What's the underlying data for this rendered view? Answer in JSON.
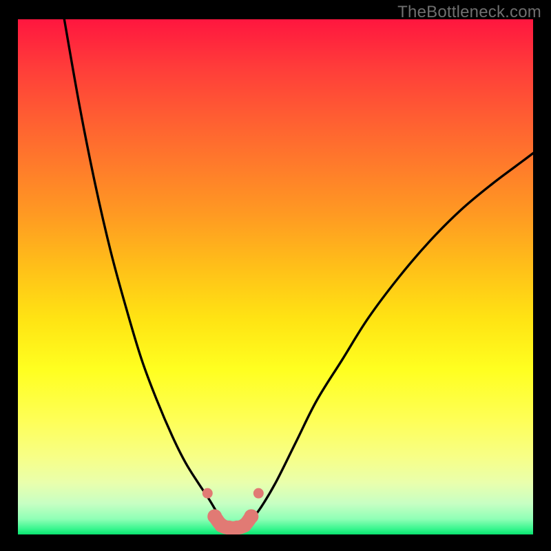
{
  "watermark": "TheBottleneck.com",
  "colors": {
    "background": "#000000",
    "curve": "#000000",
    "marker_fill": "#e17a74",
    "marker_stroke": "#d96a64",
    "watermark": "#6f6f6f"
  },
  "chart_data": {
    "type": "line",
    "title": "",
    "xlabel": "",
    "ylabel": "",
    "xlim": [
      0,
      100
    ],
    "ylim": [
      0,
      100
    ],
    "note": "Axes are unlabeled in the source image; x/y values are estimated from pixel positions on a 0–100 scale where (0,0) is bottom-left of the colored plot area.",
    "series": [
      {
        "name": "left-curve",
        "x": [
          9.0,
          12.0,
          15.0,
          18.0,
          21.0,
          24.0,
          27.0,
          30.0,
          32.5,
          35.0,
          37.0,
          38.5,
          39.5
        ],
        "y": [
          100.0,
          83.0,
          68.0,
          55.0,
          44.0,
          34.0,
          26.0,
          19.0,
          14.0,
          10.0,
          7.0,
          4.5,
          2.8
        ]
      },
      {
        "name": "right-curve",
        "x": [
          45.0,
          47.0,
          50.0,
          54.0,
          58.0,
          63.0,
          68.0,
          74.0,
          80.0,
          86.0,
          92.0,
          98.0,
          100.0
        ],
        "y": [
          2.5,
          5.0,
          10.0,
          18.0,
          26.0,
          34.0,
          42.0,
          50.0,
          57.0,
          63.0,
          68.0,
          72.5,
          74.0
        ]
      },
      {
        "name": "valley-marker-band",
        "x": [
          36.8,
          38.2,
          39.5,
          41.0,
          42.5,
          44.0,
          45.3,
          46.7
        ],
        "y": [
          8.0,
          3.5,
          1.8,
          1.3,
          1.3,
          1.8,
          3.5,
          8.0
        ]
      }
    ],
    "markers": {
      "note": "Salmon-colored dotted band across the valley floor",
      "points": [
        {
          "x": 36.8,
          "y": 8.0
        },
        {
          "x": 38.2,
          "y": 3.5
        },
        {
          "x": 39.5,
          "y": 1.8
        },
        {
          "x": 41.0,
          "y": 1.3
        },
        {
          "x": 42.5,
          "y": 1.3
        },
        {
          "x": 44.0,
          "y": 1.8
        },
        {
          "x": 45.3,
          "y": 3.5
        },
        {
          "x": 46.7,
          "y": 8.0
        }
      ]
    }
  }
}
